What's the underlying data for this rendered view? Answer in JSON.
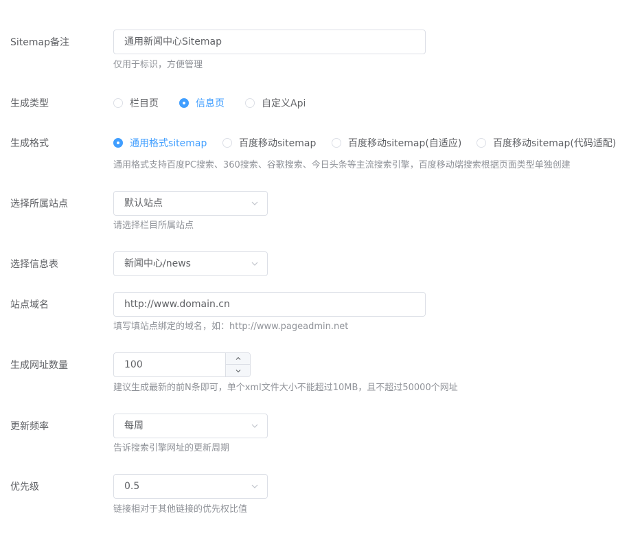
{
  "form": {
    "sitemap_note": {
      "label": "Sitemap备注",
      "value": "通用新闻中心Sitemap",
      "help": "仅用于标识，方便管理"
    },
    "gen_type": {
      "label": "生成类型",
      "options": [
        "栏目页",
        "信息页",
        "自定义Api"
      ],
      "selected_index": 1
    },
    "gen_format": {
      "label": "生成格式",
      "options": [
        "通用格式sitemap",
        "百度移动sitemap",
        "百度移动sitemap(自适应)",
        "百度移动sitemap(代码适配)"
      ],
      "selected_index": 0,
      "help": "通用格式支持百度PC搜索、360搜索、谷歌搜索、今日头条等主流搜索引擎，百度移动端搜索根据页面类型单独创建"
    },
    "site": {
      "label": "选择所属站点",
      "value": "默认站点",
      "help": "请选择栏目所属站点"
    },
    "info_table": {
      "label": "选择信息表",
      "value": "新闻中心/news"
    },
    "domain": {
      "label": "站点域名",
      "value": "http://www.domain.cn",
      "help": "填写填站点绑定的域名，如：http://www.pageadmin.net"
    },
    "url_count": {
      "label": "生成网址数量",
      "value": "100",
      "help": "建议生成最新的前N条即可，单个xml文件大小不能超过10MB，且不超过50000个网址"
    },
    "frequency": {
      "label": "更新频率",
      "value": "每周",
      "help": "告诉搜索引擎网址的更新周期"
    },
    "priority": {
      "label": "优先级",
      "value": "0.5",
      "help": "链接相对于其他链接的优先权比值"
    }
  },
  "colors": {
    "accent": "#409eff",
    "border": "#dcdfe6",
    "text": "#606266",
    "help": "#909399"
  },
  "icons": {
    "select_arrow": "chevron-down-icon",
    "step_up": "chevron-up-icon",
    "step_down": "chevron-down-icon"
  }
}
